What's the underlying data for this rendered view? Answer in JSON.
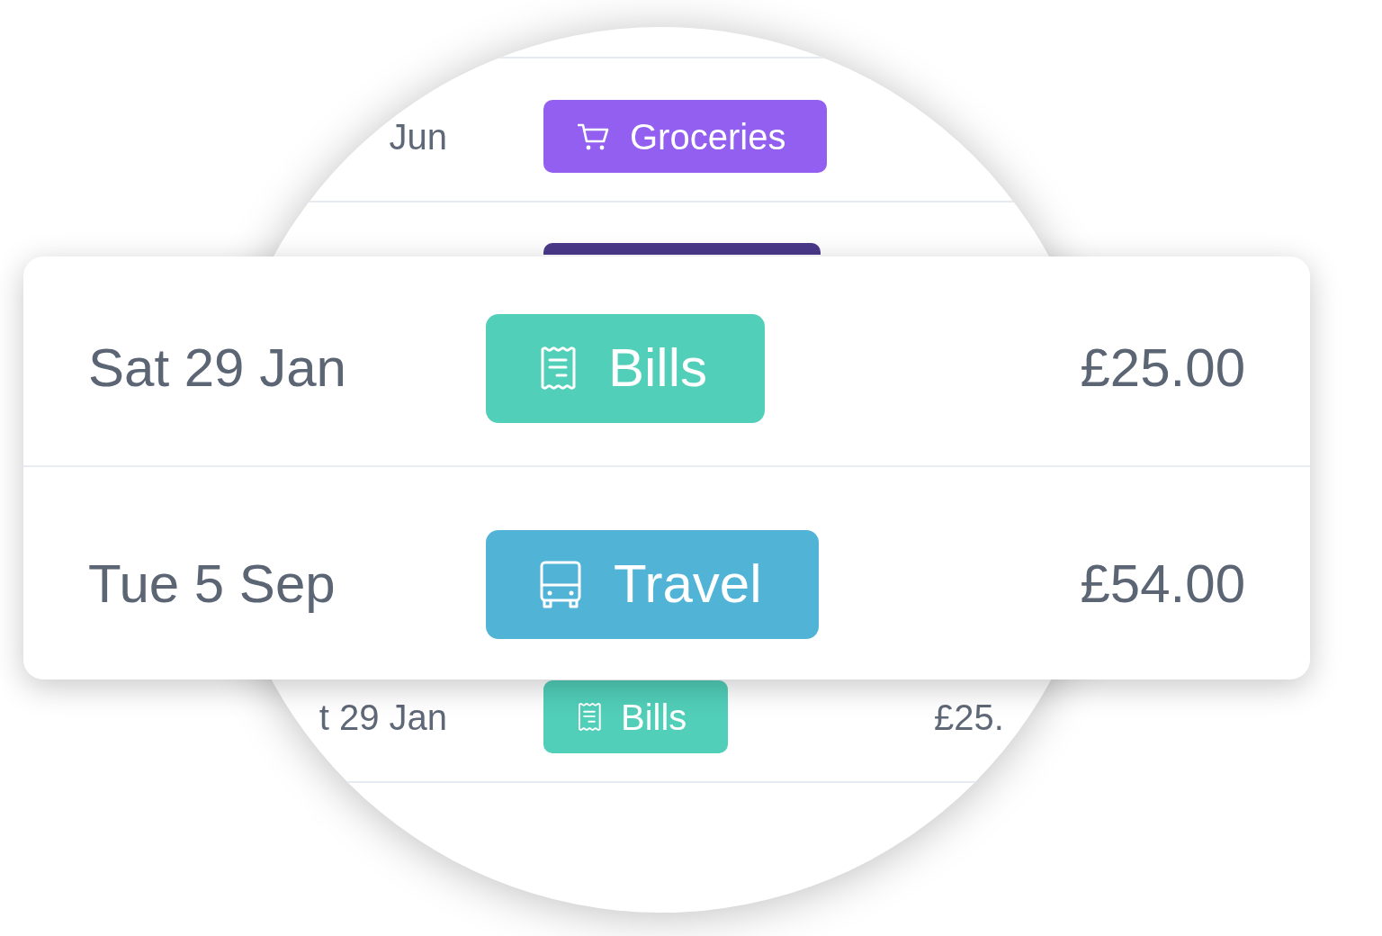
{
  "background_table": {
    "rows": [
      {
        "date": "Jun",
        "tag": {
          "kind": "groceries",
          "label": "Groceries",
          "color": "#935ff0"
        }
      },
      {
        "tag": {
          "color": "#4a3a8a"
        }
      },
      {
        "date": "t 29 Jan",
        "tag": {
          "kind": "bills",
          "label": "Bills",
          "color": "#51cfb9"
        },
        "amount": "£25."
      }
    ]
  },
  "card": {
    "rows": [
      {
        "date": "Sat 29 Jan",
        "tag": {
          "kind": "bills",
          "label": "Bills",
          "color": "#51cfb9"
        },
        "amount": "£25.00"
      },
      {
        "date": "Tue 5 Sep",
        "tag": {
          "kind": "travel",
          "label": "Travel",
          "color": "#51b4d6"
        },
        "amount": "£54.00"
      }
    ]
  }
}
